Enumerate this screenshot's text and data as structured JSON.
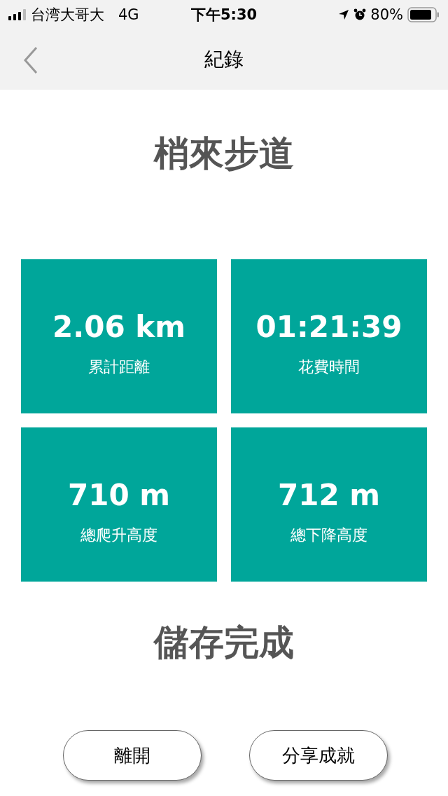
{
  "status_bar": {
    "carrier": "台湾大哥大",
    "network": "4G",
    "time": "下午5:30",
    "battery": "80%"
  },
  "nav": {
    "title": "紀錄"
  },
  "trail_name": "梢來步道",
  "stats": [
    {
      "value": "2.06 km",
      "label": "累計距離"
    },
    {
      "value": "01:21:39",
      "label": "花費時間"
    },
    {
      "value": "710 m",
      "label": "總爬升高度"
    },
    {
      "value": "712 m",
      "label": "總下降高度"
    }
  ],
  "message": "儲存完成",
  "buttons": [
    "離開",
    "分享成就"
  ]
}
